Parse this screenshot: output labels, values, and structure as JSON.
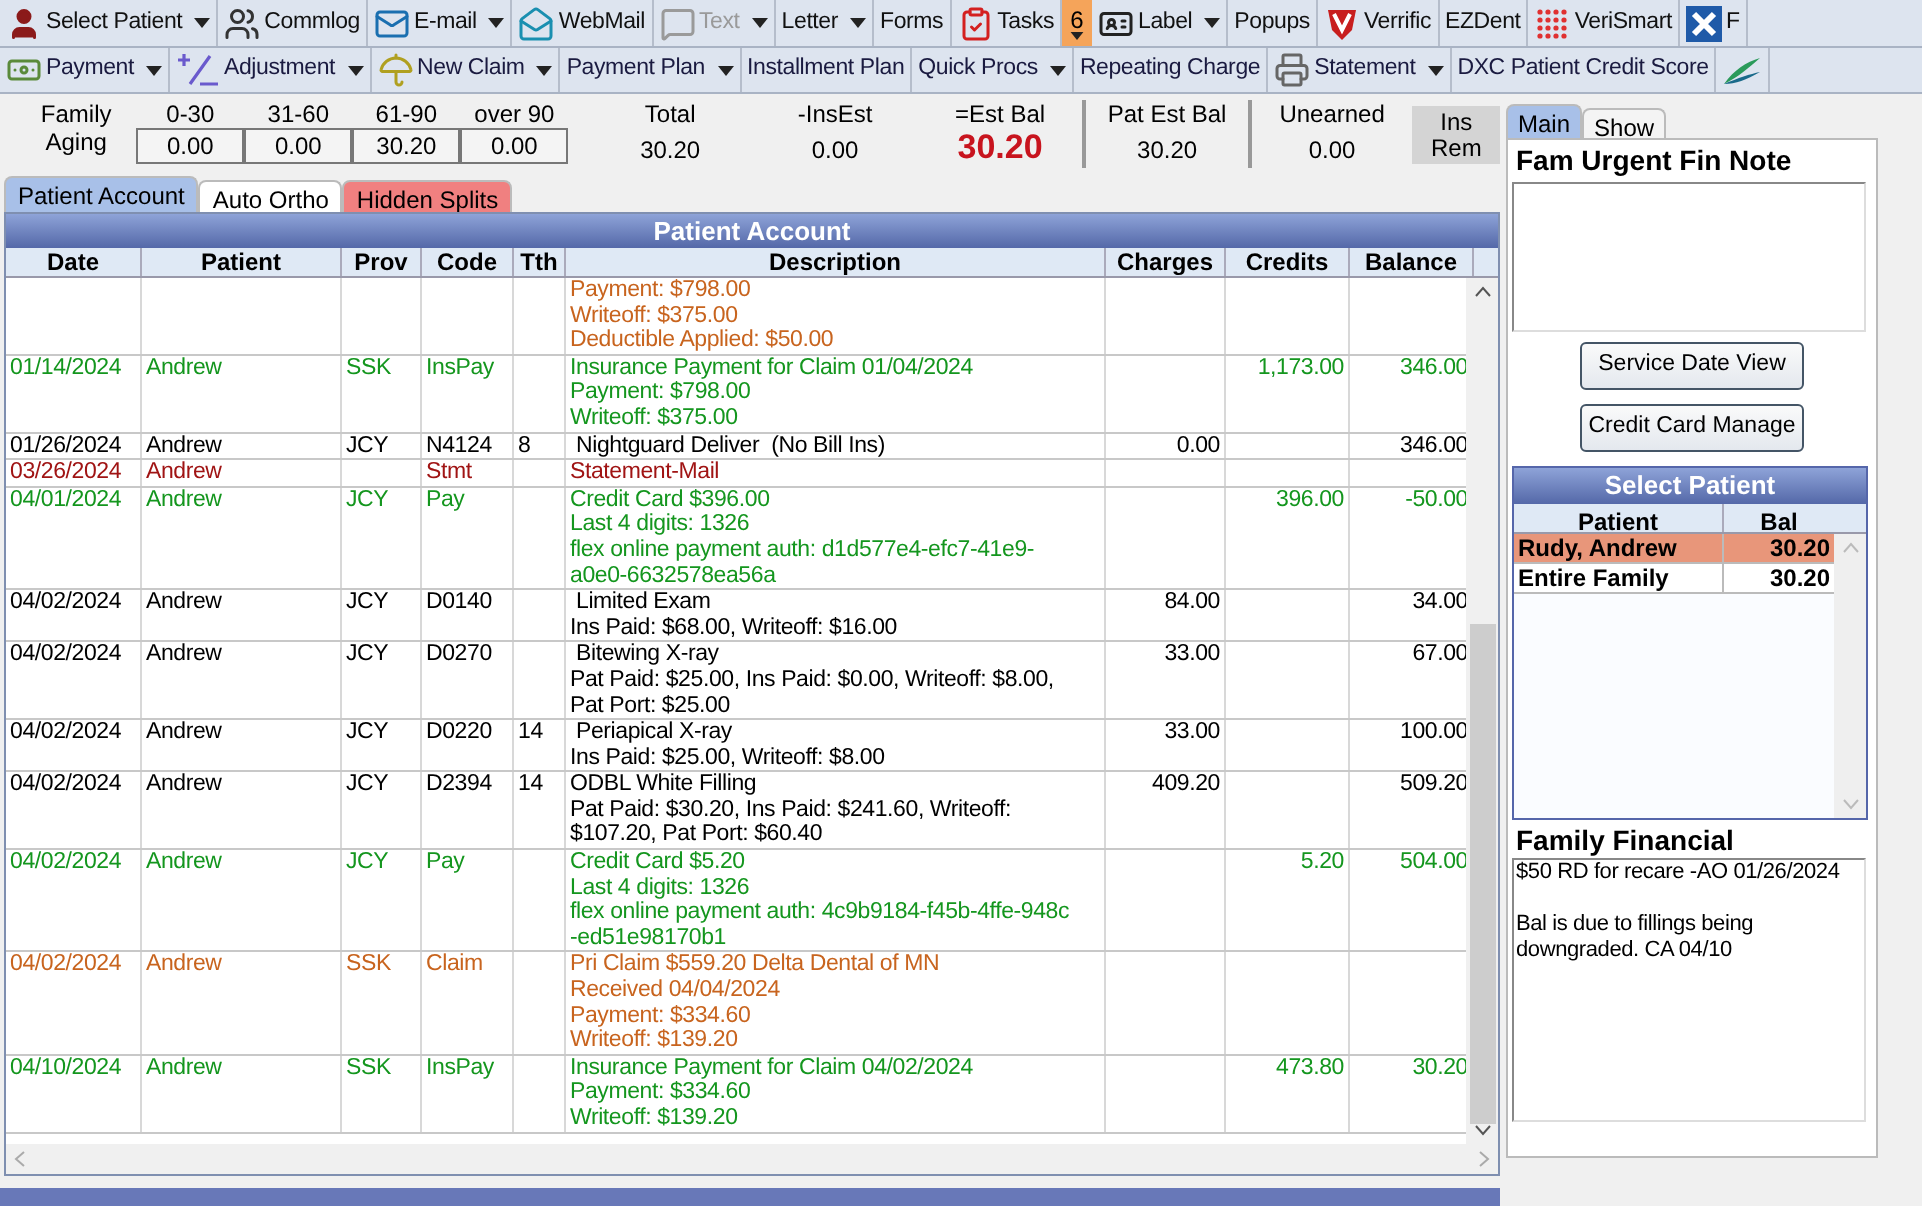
{
  "toolbar_main": [
    {
      "label": "Select Patient",
      "dropdown": true,
      "disabled": false
    },
    {
      "label": "Commlog",
      "dropdown": false,
      "disabled": false
    },
    {
      "label": "E-mail",
      "dropdown": true,
      "disabled": false
    },
    {
      "label": "WebMail",
      "dropdown": false,
      "disabled": false
    },
    {
      "label": "Text",
      "dropdown": true,
      "disabled": true
    },
    {
      "label": "Letter",
      "dropdown": true,
      "disabled": false
    },
    {
      "label": "Forms",
      "dropdown": false,
      "disabled": false
    },
    {
      "label": "Tasks",
      "dropdown": false,
      "disabled": false,
      "badge": "6"
    },
    {
      "label": "Label",
      "dropdown": true,
      "disabled": false
    },
    {
      "label": "Popups",
      "dropdown": false,
      "disabled": false
    },
    {
      "label": "Verrific",
      "dropdown": false,
      "disabled": false
    },
    {
      "label": "EZDent",
      "dropdown": false,
      "disabled": false
    },
    {
      "label": "VeriSmart",
      "dropdown": false,
      "disabled": false
    },
    {
      "label": "F",
      "dropdown": false,
      "disabled": false
    }
  ],
  "toolbar_account": [
    {
      "label": "Payment",
      "dropdown": true
    },
    {
      "label": "Adjustment",
      "dropdown": true
    },
    {
      "label": "New Claim",
      "dropdown": true
    },
    {
      "label": "Payment Plan",
      "dropdown": true
    },
    {
      "label": "Installment Plan",
      "dropdown": false
    },
    {
      "label": "Quick Procs",
      "dropdown": true
    },
    {
      "label": "Repeating Charge",
      "dropdown": false
    },
    {
      "label": "Statement",
      "dropdown": true
    },
    {
      "label": "DXC Patient Credit Score",
      "dropdown": false
    },
    {
      "dropdown": false
    }
  ],
  "aging": {
    "label_1": "Family",
    "label_2": "Aging",
    "buckets": [
      {
        "label": "0-30",
        "value": "0.00"
      },
      {
        "label": "31-60",
        "value": "0.00"
      },
      {
        "label": "61-90",
        "value": "30.20"
      },
      {
        "label": "over 90",
        "value": "0.00"
      }
    ]
  },
  "totals": [
    {
      "label": "Total",
      "value": "30.20",
      "kind": "plain"
    },
    {
      "label": "-InsEst",
      "value": "0.00",
      "kind": "plain"
    },
    {
      "label": "=Est Bal",
      "value": "30.20",
      "kind": "emphasis"
    },
    {
      "label": "Pat Est Bal",
      "value": "30.20",
      "kind": "divided"
    },
    {
      "label": "Unearned",
      "value": "0.00",
      "kind": "divided"
    }
  ],
  "ins_rem_button": {
    "line_1": "Ins",
    "line_2": "Rem"
  },
  "tabs": [
    {
      "label": "Patient Account",
      "selected": true
    },
    {
      "label": "Auto Ortho",
      "selected": false
    },
    {
      "label": "Hidden Splits",
      "selected": false,
      "color": "#f08080"
    }
  ],
  "table": {
    "title": "Patient Account",
    "columns": [
      "Date",
      "Patient",
      "Prov",
      "Code",
      "Tth",
      "Description",
      "Charges",
      "Credits",
      "Balance"
    ],
    "rows": [
      {
        "date": "",
        "patient": "",
        "prov": "",
        "code": "",
        "tth": "",
        "description": [
          "Payment: $798.00",
          "Writeoff: $375.00",
          "Deductible Applied: $50.00"
        ],
        "charges": "",
        "credits": "",
        "balance": "",
        "color": "#c8641e"
      },
      {
        "date": "01/14/2024",
        "patient": "Andrew",
        "prov": "SSK",
        "code": "InsPay",
        "tth": "",
        "description": [
          "Insurance Payment for Claim 01/04/2024",
          "Payment: $798.00",
          "Writeoff: $375.00"
        ],
        "charges": "",
        "credits": "1,173.00",
        "balance": "346.00",
        "color": "#14961e"
      },
      {
        "date": "01/26/2024",
        "patient": "Andrew",
        "prov": "JCY",
        "code": "N4124",
        "tth": "8",
        "description": [
          " Nightguard Deliver  (No Bill Ins)"
        ],
        "charges": "0.00",
        "credits": "",
        "balance": "346.00",
        "color": "#000000"
      },
      {
        "date": "03/26/2024",
        "patient": "Andrew",
        "prov": "",
        "code": "Stmt",
        "tth": "",
        "description": [
          "Statement-Mail"
        ],
        "charges": "",
        "credits": "",
        "balance": "",
        "color": "#a01414"
      },
      {
        "date": "04/01/2024",
        "patient": "Andrew",
        "prov": "JCY",
        "code": "Pay",
        "tth": "",
        "description": [
          "Credit Card $396.00",
          "Last 4 digits: 1326",
          "flex online payment auth: d1d577e4-efc7-41e9-",
          "a0e0-6632578ea56a"
        ],
        "charges": "",
        "credits": "396.00",
        "balance": "-50.00",
        "color": "#14961e"
      },
      {
        "date": "04/02/2024",
        "patient": "Andrew",
        "prov": "JCY",
        "code": "D0140",
        "tth": "",
        "description": [
          " Limited Exam",
          "Ins Paid: $68.00, Writeoff: $16.00"
        ],
        "charges": "84.00",
        "credits": "",
        "balance": "34.00",
        "color": "#000000"
      },
      {
        "date": "04/02/2024",
        "patient": "Andrew",
        "prov": "JCY",
        "code": "D0270",
        "tth": "",
        "description": [
          " Bitewing X-ray",
          "Pat Paid: $25.00, Ins Paid: $0.00, Writeoff: $8.00,",
          "Pat Port: $25.00"
        ],
        "charges": "33.00",
        "credits": "",
        "balance": "67.00",
        "color": "#000000"
      },
      {
        "date": "04/02/2024",
        "patient": "Andrew",
        "prov": "JCY",
        "code": "D0220",
        "tth": "14",
        "description": [
          " Periapical X-ray",
          "Ins Paid: $25.00, Writeoff: $8.00"
        ],
        "charges": "33.00",
        "credits": "",
        "balance": "100.00",
        "color": "#000000"
      },
      {
        "date": "04/02/2024",
        "patient": "Andrew",
        "prov": "JCY",
        "code": "D2394",
        "tth": "14",
        "description": [
          "ODBL White Filling",
          "Pat Paid: $30.20, Ins Paid: $241.60, Writeoff:",
          "$107.20, Pat Port: $60.40"
        ],
        "charges": "409.20",
        "credits": "",
        "balance": "509.20",
        "color": "#000000"
      },
      {
        "date": "04/02/2024",
        "patient": "Andrew",
        "prov": "JCY",
        "code": "Pay",
        "tth": "",
        "description": [
          "Credit Card $5.20",
          "Last 4 digits: 1326",
          "flex online payment auth: 4c9b9184-f45b-4ffe-948c",
          "-ed51e98170b1"
        ],
        "charges": "",
        "credits": "5.20",
        "balance": "504.00",
        "color": "#14961e"
      },
      {
        "date": "04/02/2024",
        "patient": "Andrew",
        "prov": "SSK",
        "code": "Claim",
        "tth": "",
        "description": [
          "Pri Claim $559.20 Delta Dental of MN",
          "Received 04/04/2024",
          "Payment: $334.60",
          "Writeoff: $139.20"
        ],
        "charges": "",
        "credits": "",
        "balance": "",
        "color": "#c8641e"
      },
      {
        "date": "04/10/2024",
        "patient": "Andrew",
        "prov": "SSK",
        "code": "InsPay",
        "tth": "",
        "description": [
          "Insurance Payment for Claim 04/02/2024",
          "Payment: $334.60",
          "Writeoff: $139.20"
        ],
        "charges": "",
        "credits": "473.80",
        "balance": "30.20",
        "color": "#14961e"
      }
    ]
  },
  "side_tabs": [
    {
      "label": "Main",
      "selected": true
    },
    {
      "label": "Show",
      "selected": false
    }
  ],
  "urgent_note": {
    "title": "Fam Urgent Fin Note"
  },
  "side_buttons": [
    "Service Date View",
    "Credit Card Manage"
  ],
  "select_patient": {
    "title": "Select Patient",
    "columns": [
      "Patient",
      "Bal"
    ],
    "rows": [
      {
        "patient": "Rudy, Andrew",
        "bal": "30.20",
        "selected": true
      },
      {
        "patient": "Entire Family",
        "bal": "30.20",
        "selected": false
      }
    ]
  },
  "family_financial": {
    "title": "Family Financial",
    "value": "$50 RD for recare -AO 01/26/2024\n\nBal is due to fillings being downgraded. CA 04/10"
  }
}
